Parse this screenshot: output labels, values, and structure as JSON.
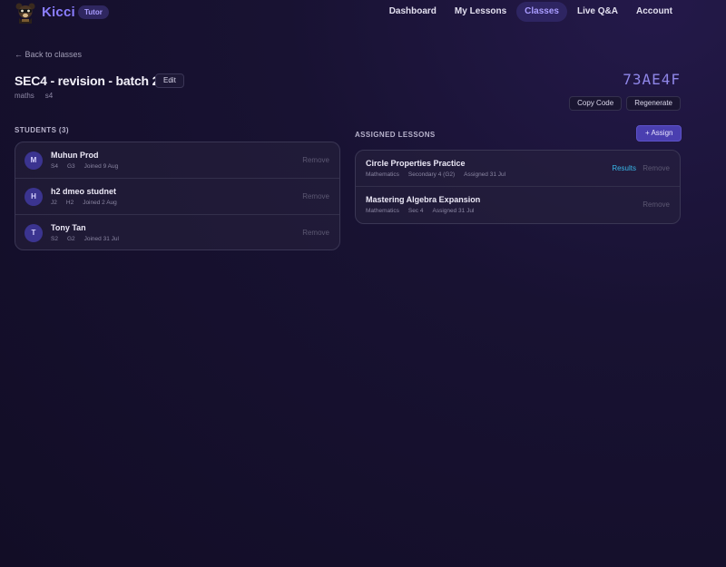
{
  "nav": {
    "brand": "Kicci",
    "role_badge": "Tutor",
    "links": [
      {
        "label": "Dashboard"
      },
      {
        "label": "My Lessons"
      },
      {
        "label": "Classes"
      },
      {
        "label": "Live Q&A"
      },
      {
        "label": "Account"
      }
    ],
    "active": "Classes"
  },
  "back_label": "← Back to classes",
  "class": {
    "title": "SEC4 - revision - batch 2",
    "edit_label": "Edit",
    "subject": "maths",
    "level": "s4",
    "code": "73AE4F",
    "copy_label": "Copy Code",
    "regenerate_label": "Regenerate"
  },
  "students": {
    "heading": "STUDENTS (3)",
    "remove_label": "Remove",
    "items": [
      {
        "initial": "M",
        "name": "Muhun Prod",
        "level": "S4",
        "group": "G3",
        "joined": "Joined 9 Aug"
      },
      {
        "initial": "H",
        "name": "h2 dmeo studnet",
        "level": "J2",
        "group": "H2",
        "joined": "Joined 2 Aug"
      },
      {
        "initial": "T",
        "name": "Tony Tan",
        "level": "S2",
        "group": "G2",
        "joined": "Joined 31 Jul"
      }
    ]
  },
  "lessons": {
    "heading": "ASSIGNED LESSONS",
    "assign_label": "+ Assign",
    "remove_label": "Remove",
    "results_label": "Results",
    "items": [
      {
        "title": "Circle Properties Practice",
        "subject": "Mathematics",
        "level": "Secondary 4 (G2)",
        "assigned": "Assigned 31 Jul"
      },
      {
        "title": "Mastering Algebra Expansion",
        "subject": "Mathematics",
        "level": "Sec 4",
        "assigned": "Assigned 31 Jul"
      }
    ]
  },
  "colors": {
    "accent": "#8a7dff",
    "active_nav_bg": "#2e2562",
    "results_link": "#38b6e8",
    "assign_button": "#4a3fb0"
  }
}
